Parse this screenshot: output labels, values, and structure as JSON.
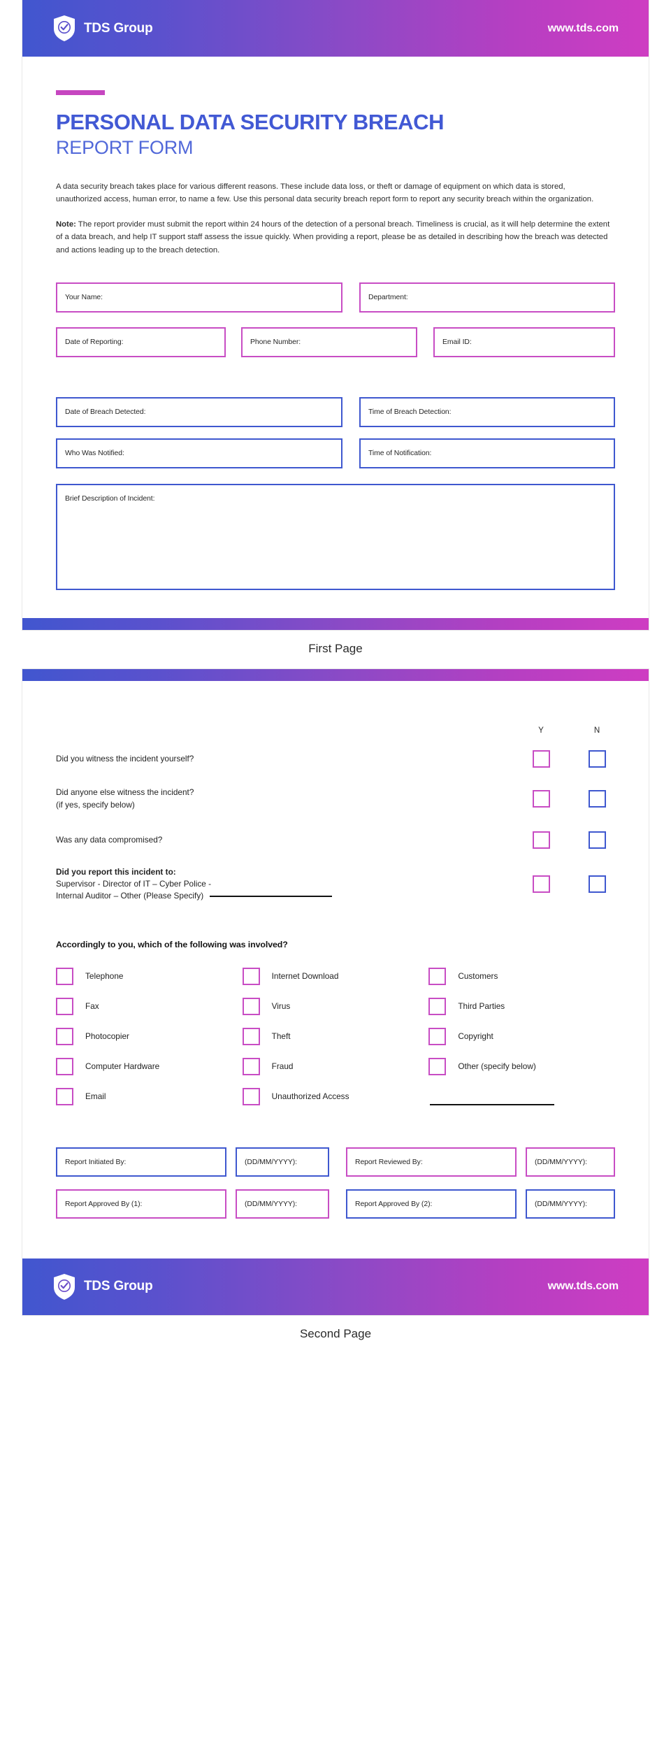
{
  "brand": {
    "name": "TDS Group",
    "url": "www.tds.com",
    "shield_icon": "shield-check-icon"
  },
  "colors": {
    "gradient_start": "#4156cf",
    "gradient_end": "#ce3dc2",
    "title_blue": "#4259d4",
    "accent_magenta": "#c646c0",
    "field_magenta": "#c84dc4",
    "field_blue": "#3f58cf"
  },
  "page1": {
    "caption": "First Page",
    "title_main": "PERSONAL DATA SECURITY BREACH",
    "title_sub": "REPORT FORM",
    "intro": "A data security breach takes place for various different reasons. These include data loss, or theft or damage of equipment on which data is stored, unauthorized access, human error, to name a few. Use this personal data security breach report form to report any security breach within the organization.",
    "note_label": "Note:",
    "note_text": " The report provider must submit the report within 24 hours of the detection of a personal breach. Timeliness is crucial, as it will help determine the extent of a data breach, and help IT support staff assess the issue quickly. When providing a report, please be as detailed in describing how the breach was detected and actions leading up to the breach detection.",
    "fields": {
      "your_name": "Your Name:",
      "department": "Department:",
      "date_of_reporting": "Date of Reporting:",
      "phone_number": "Phone Number:",
      "email_id": "Email ID:",
      "date_of_breach_detected": "Date of Breach Detected:",
      "time_of_breach_detection": "Time of Breach Detection:",
      "who_was_notified": "Who Was Notified:",
      "time_of_notification": "Time of Notification:",
      "brief_description": "Brief Description of Incident:"
    }
  },
  "page2": {
    "caption": "Second Page",
    "yn_header": {
      "yes": "Y",
      "no": "N"
    },
    "questions": [
      {
        "line1": "Did you witness the incident yourself?",
        "line2": "",
        "bold_line1": false
      },
      {
        "line1": "Did anyone else witness the incident?",
        "line2": "(if yes, specify below)",
        "bold_line1": false
      },
      {
        "line1": "Was any data compromised?",
        "line2": "",
        "bold_line1": false
      }
    ],
    "report_to": {
      "heading": "Did you report this incident to:",
      "line1": "Supervisor - Director of IT – Cyber Police -",
      "line2": "Internal Auditor – Other (Please Specify)"
    },
    "involved_title": "Accordingly to you, which of the following was involved?",
    "involved_col1": [
      "Telephone",
      "Fax",
      "Photocopier",
      "Computer Hardware",
      "Email"
    ],
    "involved_col2": [
      "Internet Download",
      "Virus",
      "Theft",
      "Fraud",
      "Unauthorized Access"
    ],
    "involved_col3": [
      "Customers",
      "Third Parties",
      "Copyright",
      "Other (specify below)"
    ],
    "signoff": {
      "report_initiated_by": "Report Initiated By:",
      "date1": "(DD/MM/YYYY):",
      "report_reviewed_by": "Report Reviewed By:",
      "date2": "(DD/MM/YYYY):",
      "report_approved_by_1": "Report Approved By (1):",
      "date3": "(DD/MM/YYYY):",
      "report_approved_by_2": "Report Approved By (2):",
      "date4": "(DD/MM/YYYY):"
    }
  }
}
